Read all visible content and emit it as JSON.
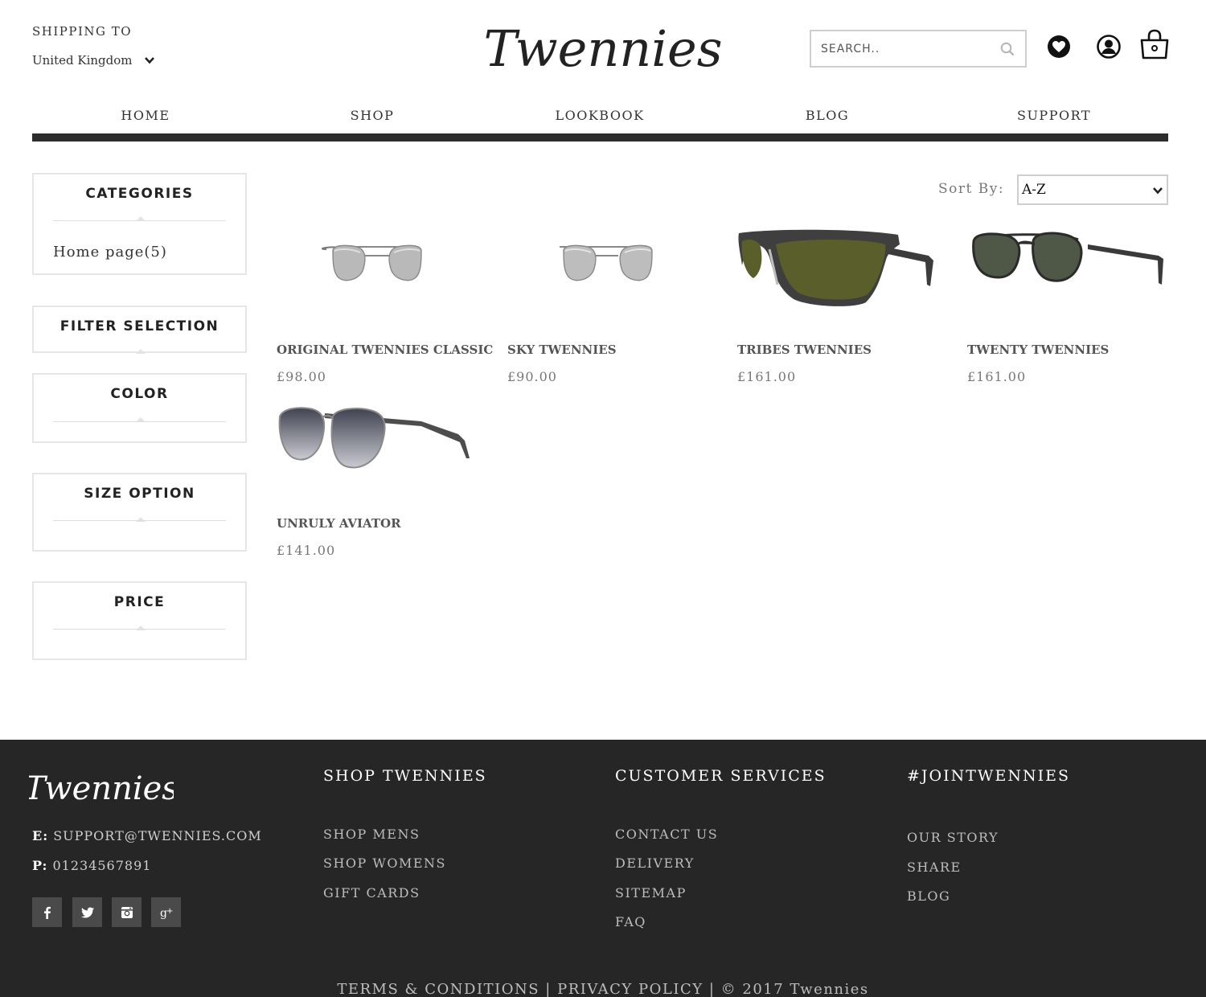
{
  "header": {
    "shipping_label": "SHIPPING TO",
    "shipping_country": "United Kingdom",
    "brand": "Twennies",
    "search_placeholder": "SEARCH.."
  },
  "nav": [
    {
      "label": "HOME"
    },
    {
      "label": "SHOP"
    },
    {
      "label": "LOOKBOOK"
    },
    {
      "label": "BLOG"
    },
    {
      "label": "SUPPORT"
    }
  ],
  "sidebar": {
    "categories_title": "CATEGORIES",
    "category_link": "Home page(5)",
    "filter_title": "FILTER SELECTION",
    "color_title": "COLOR",
    "size_title": "SIZE OPTION",
    "price_title": "PRICE"
  },
  "sort": {
    "label": "Sort By:",
    "value": "A-Z"
  },
  "products": [
    {
      "name": "ORIGINAL TWENNIES CLASSIC",
      "price": "£98.00",
      "lens": "#b9b9b9"
    },
    {
      "name": "SKY TWENNIES",
      "price": "£90.00",
      "lens": "#bdbdbd"
    },
    {
      "name": "TRIBES TWENNIES",
      "price": "£161.00",
      "lens": "#5a5e2a"
    },
    {
      "name": "TWENTY TWENNIES",
      "price": "£161.00",
      "lens": "#4f5846"
    },
    {
      "name": "UNRULY AVIATOR",
      "price": "£141.00",
      "lens": "#6a6c78"
    }
  ],
  "footer": {
    "brand": "Twennies",
    "email_label": "E:",
    "email": "SUPPORT@TWENNIES.COM",
    "phone_label": "P:",
    "phone": "01234567891",
    "col1_title": "SHOP TWENNIES",
    "col1_links": [
      "SHOP MENS",
      "SHOP WOMENS",
      "GIFT CARDS"
    ],
    "col2_title": "CUSTOMER SERVICES",
    "col2_links": [
      "CONTACT US",
      "DELIVERY",
      "SITEMAP",
      "FAQ"
    ],
    "col3_title": "#JOINTWENNIES",
    "col3_links": [
      "OUR STORY",
      "SHARE",
      "BLOG"
    ],
    "terms": "TERMS & CONDITIONS",
    "privacy": "PRIVACY POLICY",
    "copyright": "© 2017 Twennies",
    "separator": "|"
  },
  "icons": {
    "wishlist": "heart-icon",
    "account": "user-icon",
    "cart": "shopping-bag-icon",
    "search": "search-icon",
    "social": [
      "facebook-icon",
      "twitter-icon",
      "instagram-icon",
      "google-plus-icon"
    ]
  }
}
